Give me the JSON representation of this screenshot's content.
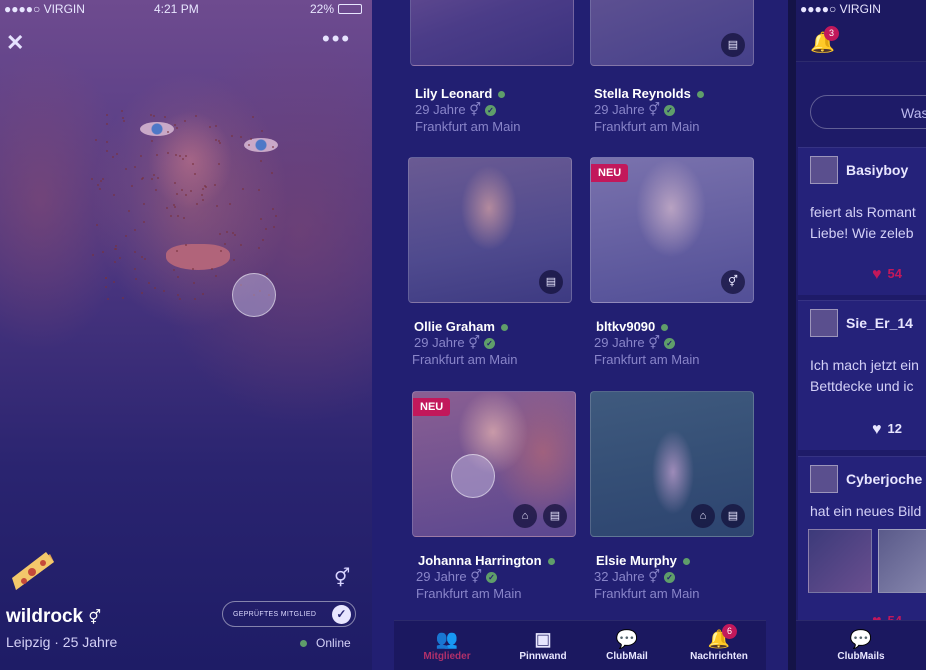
{
  "left": {
    "status": {
      "carrier": "●●●●○ VIRGIN",
      "time": "4:21 PM",
      "battery": "22%"
    },
    "close_icon": "close-icon",
    "more_icon": "more-dots-icon",
    "username": "wildrock",
    "gender_symbol": "⚥",
    "location_age": "Leipzig · 25 Jahre",
    "verified_label": "GEPRÜFTES MITGLIED",
    "online_label": "Online"
  },
  "members": [
    {
      "name": "Lily Leonard",
      "age": "29 Jahre",
      "city": "Frankfurt am Main",
      "new": false
    },
    {
      "name": "Stella Reynolds",
      "age": "29 Jahre",
      "city": "Frankfurt am Main",
      "new": false
    },
    {
      "name": "Ollie Graham",
      "age": "29 Jahre",
      "city": "Frankfurt am Main",
      "new": false
    },
    {
      "name": "bltkv9090",
      "age": "29 Jahre",
      "city": "Frankfurt am Main",
      "new": true
    },
    {
      "name": "Johanna Harrington",
      "age": "29 Jahre",
      "city": "Frankfurt am Main",
      "new": true
    },
    {
      "name": "Elsie Murphy",
      "age": "32 Jahre",
      "city": "Frankfurt am Main",
      "new": false
    }
  ],
  "new_badge": "NEU",
  "tabs": [
    {
      "label": "Mitglieder",
      "icon": "members-icon"
    },
    {
      "label": "Pinnwand",
      "icon": "board-icon"
    },
    {
      "label": "ClubMail",
      "icon": "chat-icon"
    },
    {
      "label": "Nachrichten",
      "icon": "bell-icon",
      "badge": "6"
    }
  ],
  "right": {
    "status_carrier": "●●●●○ VIRGIN",
    "bell_badge": "3",
    "search_pill": "Was",
    "posts": [
      {
        "user": "Basiyboy",
        "text_line1": "feiert als Romant",
        "text_line2": "Liebe! Wie zeleb",
        "likes": "54",
        "liked": true
      },
      {
        "user": "Sie_Er_14",
        "text_line1": "Ich mach jetzt ein",
        "text_line2": "Bettdecke und ic",
        "likes": "12",
        "liked": false
      },
      {
        "user": "Cyberjoche",
        "text_line1": "hat ein neues Bild",
        "likes": "54",
        "liked": true
      }
    ],
    "tab_label": "ClubMails"
  },
  "colors": {
    "accent": "#c2185b",
    "online": "#5f9e6a",
    "bg": "#221f72"
  }
}
